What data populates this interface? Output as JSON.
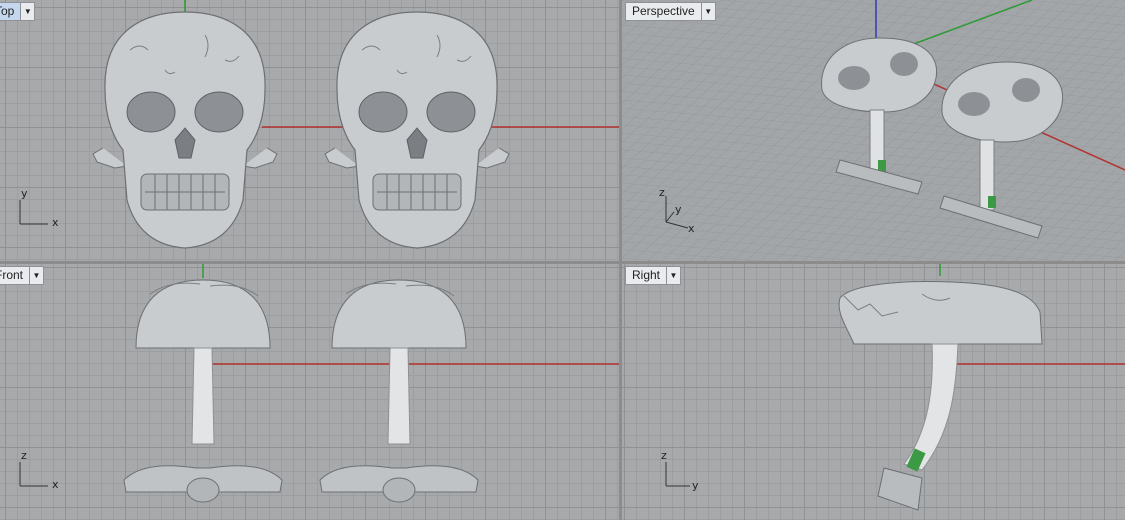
{
  "viewports": {
    "top": {
      "title": "Top",
      "axis_h": "x",
      "axis_v": "y"
    },
    "perspective": {
      "title": "Perspective",
      "axis_h": "x",
      "axis_v": "y",
      "axis_z": "z"
    },
    "front": {
      "title": "Front",
      "axis_h": "x",
      "axis_v": "z"
    },
    "right": {
      "title": "Right",
      "axis_h": "y",
      "axis_v": "z"
    }
  },
  "menu_arrow": "▼",
  "colors": {
    "x_axis": "#b2322f",
    "y_axis": "#2d9a35",
    "z_axis": "#2f38b8",
    "model_metal": "#c9cccf",
    "grid": "#a7a9ab",
    "active_tab": "#c4d7ee"
  },
  "model": {
    "object": "skull cufflink",
    "count": 2
  }
}
